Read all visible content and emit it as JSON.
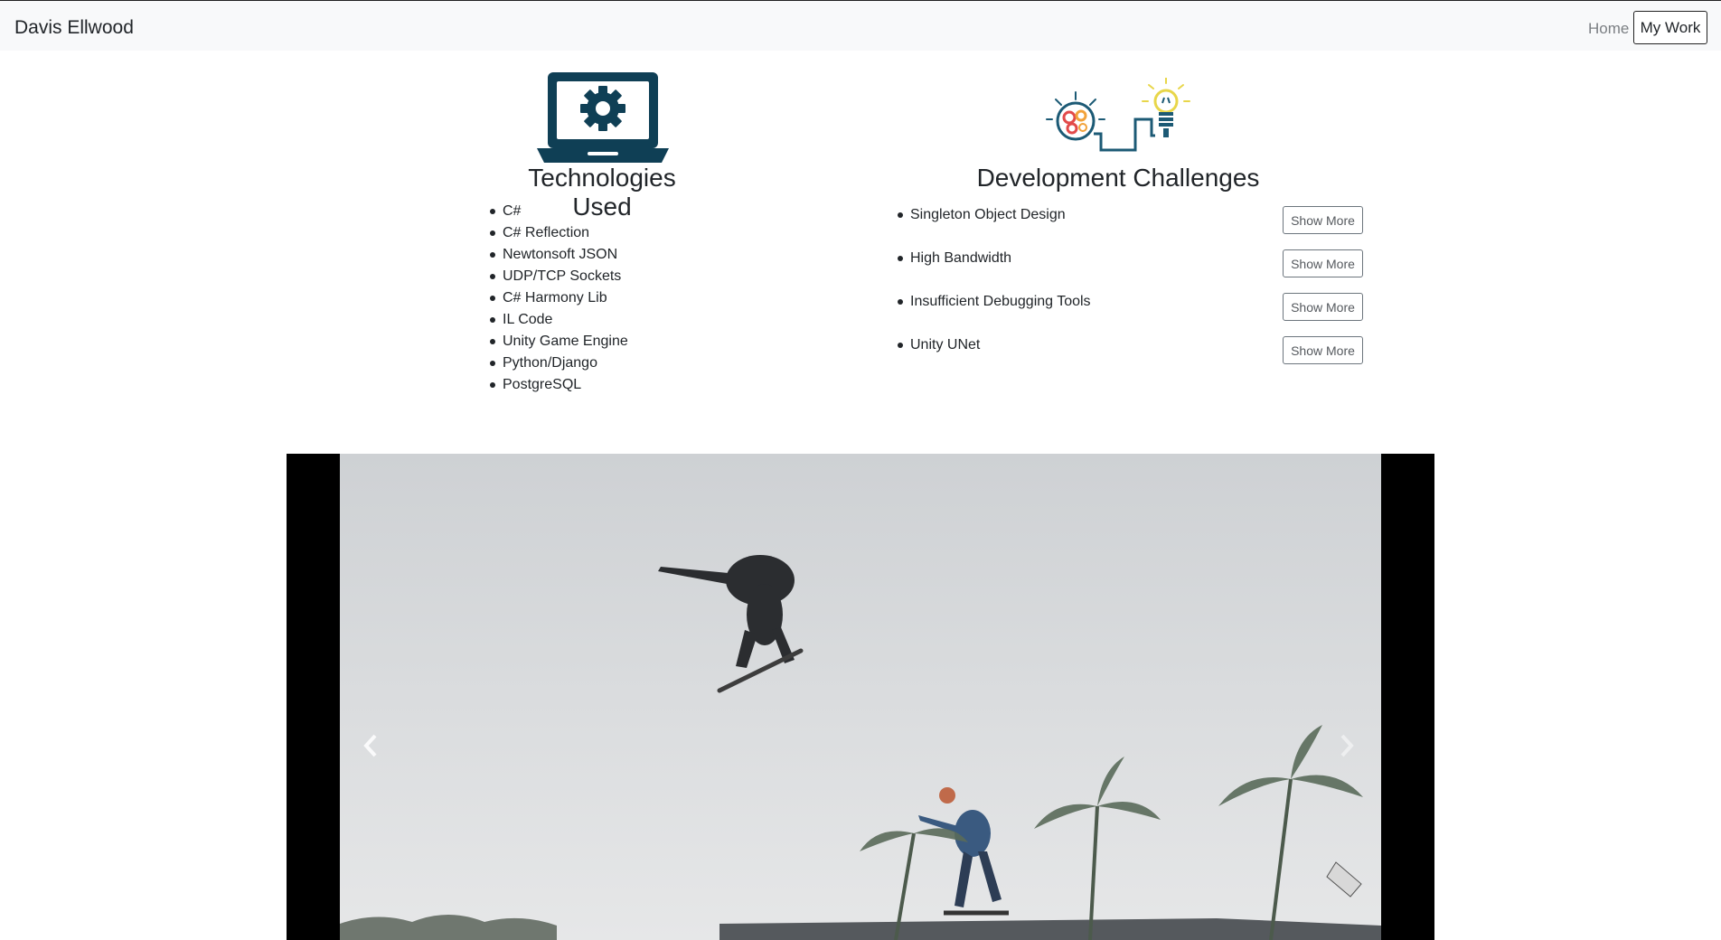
{
  "navbar": {
    "brand": "Davis Ellwood",
    "links": [
      {
        "label": "Home",
        "active": false
      },
      {
        "label": "My Work",
        "active": true
      }
    ]
  },
  "technologies": {
    "icon": "laptop-gear-icon",
    "title": "Technologies Used",
    "items": [
      "C#",
      "C# Reflection",
      "Newtonsoft JSON",
      "UDP/TCP Sockets",
      "C# Harmony Lib",
      "IL Code",
      "Unity Game Engine",
      "Python/Django",
      "PostgreSQL"
    ]
  },
  "challenges": {
    "icon": "brain-lightbulb-icon",
    "title": "Development Challenges",
    "button_label": "Show More",
    "items": [
      "Singleton Object Design",
      "High Bandwidth",
      "Insufficient Debugging Tools",
      "Unity UNet"
    ]
  },
  "media": {
    "type": "video",
    "content": "skateboarding-gameplay-video",
    "controls": [
      "previous-chevron-icon",
      "next-chevron-icon"
    ]
  },
  "colors": {
    "navbar_bg": "#f8f9fa",
    "icon_navy": "#0f3f55",
    "button_border": "#6c757d",
    "video_bg": "#000000"
  }
}
